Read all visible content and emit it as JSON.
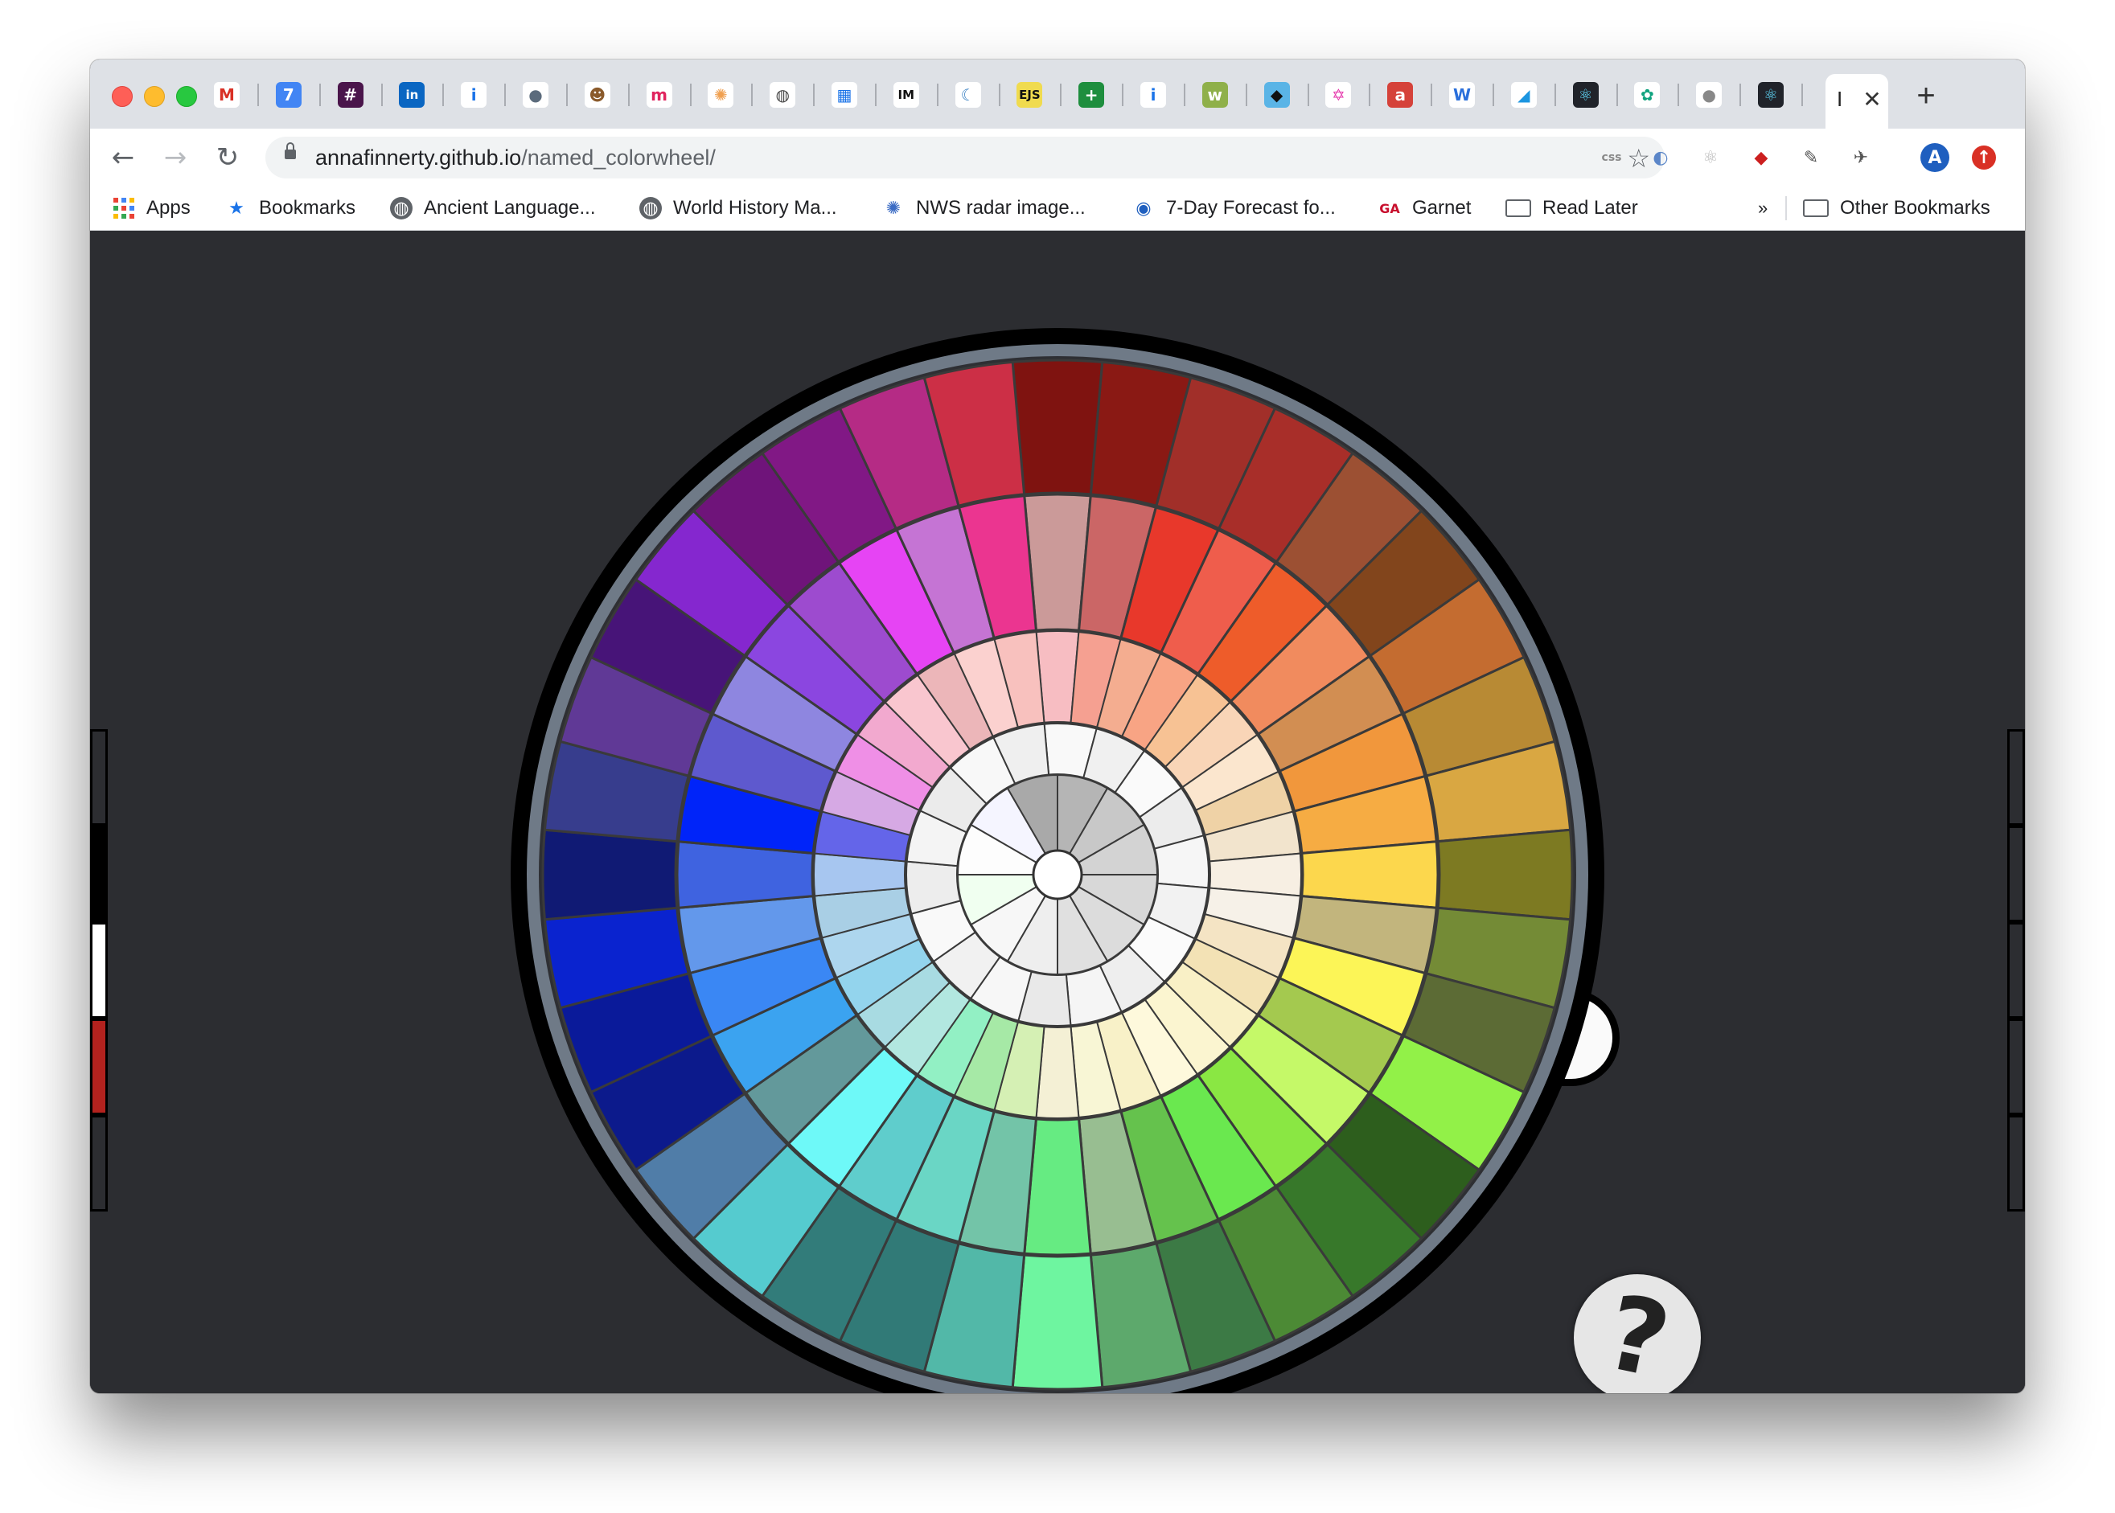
{
  "browser": {
    "pinned_tabs": [
      {
        "icon": "gmail-icon",
        "glyph": "M",
        "bg": "#ffffff",
        "fg": "#d93025"
      },
      {
        "icon": "calendar-icon",
        "glyph": "7",
        "bg": "#4285f4",
        "fg": "#ffffff"
      },
      {
        "icon": "slack-icon",
        "glyph": "#",
        "bg": "#4a154b",
        "fg": "#ffffff"
      },
      {
        "icon": "linkedin-icon",
        "glyph": "in",
        "bg": "#0a66c2",
        "fg": "#ffffff"
      },
      {
        "icon": "info-icon",
        "glyph": "i",
        "bg": "#ffffff",
        "fg": "#1a73e8"
      },
      {
        "icon": "profile-icon",
        "glyph": "●",
        "bg": "#ffffff",
        "fg": "#5b6b7c"
      },
      {
        "icon": "meerkat-icon",
        "glyph": "☻",
        "bg": "#ffffff",
        "fg": "#8a5a2b"
      },
      {
        "icon": "m-logo-icon",
        "glyph": "m",
        "bg": "#ffffff",
        "fg": "#e0245e"
      },
      {
        "icon": "sparkle-icon",
        "glyph": "✺",
        "bg": "#ffffff",
        "fg": "#f0a050"
      },
      {
        "icon": "globe-icon",
        "glyph": "◍",
        "bg": "#ffffff",
        "fg": "#444444"
      },
      {
        "icon": "grid-icon",
        "glyph": "▦",
        "bg": "#ffffff",
        "fg": "#1a73e8"
      },
      {
        "icon": "im-icon",
        "glyph": "IM",
        "bg": "#ffffff",
        "fg": "#111111"
      },
      {
        "icon": "moon-icon",
        "glyph": "☾",
        "bg": "#ffffff",
        "fg": "#3b82c4"
      },
      {
        "icon": "ejs-icon",
        "glyph": "EJS",
        "bg": "#f0db4f",
        "fg": "#111111"
      },
      {
        "icon": "plus-doc-icon",
        "glyph": "+",
        "bg": "#1e8e3e",
        "fg": "#ffffff"
      },
      {
        "icon": "info-icon",
        "glyph": "i",
        "bg": "#ffffff",
        "fg": "#1a73e8"
      },
      {
        "icon": "wp-icon",
        "glyph": "w",
        "bg": "#8fb04a",
        "fg": "#ffffff"
      },
      {
        "icon": "bird-icon",
        "glyph": "◆",
        "bg": "#5ab4e6",
        "fg": "#111111"
      },
      {
        "icon": "graphql-icon",
        "glyph": "✡",
        "bg": "#ffffff",
        "fg": "#e535ab"
      },
      {
        "icon": "a-icon",
        "glyph": "a",
        "bg": "#d5423a",
        "fg": "#ffffff"
      },
      {
        "icon": "w-icon",
        "glyph": "W",
        "bg": "#ffffff",
        "fg": "#2a6fdb"
      },
      {
        "icon": "flag-icon",
        "glyph": "◢",
        "bg": "#ffffff",
        "fg": "#1b95e0"
      },
      {
        "icon": "react-icon",
        "glyph": "⚛",
        "bg": "#20232a",
        "fg": "#61dafb"
      },
      {
        "icon": "openai-icon",
        "glyph": "✿",
        "bg": "#ffffff",
        "fg": "#10a37f"
      },
      {
        "icon": "apple-icon",
        "glyph": "●",
        "bg": "#ffffff",
        "fg": "#888888"
      },
      {
        "icon": "react-icon",
        "glyph": "⚛",
        "bg": "#20232a",
        "fg": "#61dafb"
      }
    ],
    "active_tab": {
      "icon": "page-icon",
      "glyph": "I",
      "close": "✕"
    },
    "new_tab": "+",
    "nav": {
      "back": "←",
      "forward": "→",
      "reload": "↻"
    },
    "url_host": "annafinnerty.github.io",
    "url_path": "/named_colorwheel/",
    "star": "☆",
    "extensions": [
      {
        "icon": "css-icon",
        "glyph": "css",
        "color": "#8a8a8a"
      },
      {
        "icon": "shield-icon",
        "glyph": "◐",
        "color": "#5b86c8"
      },
      {
        "icon": "react-devtools-icon",
        "glyph": "⚛",
        "color": "#bbbbbb"
      },
      {
        "icon": "ruby-icon",
        "glyph": "◆",
        "color": "#cc1f1f"
      },
      {
        "icon": "eyedropper-icon",
        "glyph": "✎",
        "color": "#555555"
      },
      {
        "icon": "plane-icon",
        "glyph": "✈",
        "color": "#555555"
      },
      {
        "icon": "avatar-icon",
        "glyph": "A",
        "color": "#1f5fbf"
      },
      {
        "icon": "update-icon",
        "glyph": "↑",
        "color": "#d93025"
      }
    ],
    "bookmarks": [
      {
        "icon": "apps-icon",
        "label": "Apps"
      },
      {
        "icon": "star-icon",
        "label": "Bookmarks"
      },
      {
        "icon": "globe-icon",
        "label": "Ancient Language..."
      },
      {
        "icon": "globe-icon",
        "label": "World History Ma..."
      },
      {
        "icon": "radar-icon",
        "label": "NWS radar image..."
      },
      {
        "icon": "weather-icon",
        "label": "7-Day Forecast fo..."
      },
      {
        "icon": "ga-icon",
        "label": "Garnet"
      },
      {
        "icon": "folder-icon",
        "label": "Read Later"
      }
    ],
    "overflow": "»",
    "other_bookmarks": "Other Bookmarks",
    "ga_text": "GA"
  },
  "page": {
    "help_label": "?",
    "side_swatches": [
      "#2c2d31",
      "#000000",
      "#ffffff",
      "#b3221e",
      "#2c2d31"
    ],
    "wheel": {
      "rings": [
        {
          "name": "outer",
          "colors": [
            "#7f1310",
            "#8a1914",
            "#a12f29",
            "#a82e29",
            "#9c5033",
            "#82451c",
            "#c46c30",
            "#b88a34",
            "#d9a742",
            "#7d7a22",
            "#748b36",
            "#5c6b35",
            "#92f148",
            "#2d5e1d",
            "#37782a",
            "#4c8a35",
            "#3c7a45",
            "#5da96c",
            "#6ef5a0",
            "#52b8a8",
            "#317a77",
            "#327c7a",
            "#55cbcf",
            "#507da8",
            "#0c1a8c",
            "#0a1a9a",
            "#0a23cf",
            "#101a74",
            "#373d8d",
            "#603996",
            "#471478",
            "#8527cf",
            "#6f147a",
            "#811885",
            "#b52b85",
            "#cc2f46"
          ]
        },
        {
          "name": "second",
          "colors": [
            "#cb9a99",
            "#cb6666",
            "#e8382b",
            "#ef5d4c",
            "#ee5c2a",
            "#f18b5e",
            "#d28e52",
            "#f1973c",
            "#f6ac43",
            "#fcd74d",
            "#c2b57d",
            "#fcf557",
            "#a4c94f",
            "#c5f968",
            "#8ae743",
            "#6ae84f",
            "#65c24d",
            "#98be91",
            "#66eb82",
            "#73c4a8",
            "#6ad6c5",
            "#5fcdcc",
            "#6ef9f8",
            "#63999b",
            "#3ba3f0",
            "#3a87f4",
            "#6398eb",
            "#3f63e0",
            "#0024f9",
            "#5e59ce",
            "#8e86e0",
            "#8b46e0",
            "#9d4bcf",
            "#e644f4",
            "#c574d4",
            "#eb3590"
          ]
        },
        {
          "name": "third",
          "colors": [
            "#f7bdc2",
            "#f5a091",
            "#f4ad90",
            "#f8a484",
            "#f7c294",
            "#f9d5b7",
            "#fbe6ce",
            "#efd2a6",
            "#f2e4cd",
            "#f7efe3",
            "#f6f1e8",
            "#f4e4c4",
            "#f3e2b5",
            "#f9f0c6",
            "#fbf5d0",
            "#fef9dc",
            "#f8f1c8",
            "#f8f6d5",
            "#f4f0d5",
            "#d5f0b4",
            "#a6e9a6",
            "#92f0c4",
            "#b2e7e0",
            "#a8dbe2",
            "#93d4ed",
            "#add6ee",
            "#a9cfe5",
            "#a7c6f0",
            "#6465e9",
            "#d6a9e4",
            "#ef8fe6",
            "#f2a9cf",
            "#f9c6cf",
            "#ecb6b9",
            "#fbd1cf",
            "#f8c1be"
          ]
        },
        {
          "name": "fourth",
          "colors": [
            "#f9f9f9",
            "#f0f0f0",
            "#fafafa",
            "#ececec",
            "#f6f6f6",
            "#f2f2f2",
            "#fbfbfb",
            "#eeeeee",
            "#f5f5f5",
            "#e9e9e9",
            "#f7f7f7",
            "#f1f1f1",
            "#f9f9f9",
            "#ededed",
            "#f4f4f4",
            "#ebebeb",
            "#f8f8f8",
            "#efefef"
          ]
        },
        {
          "name": "center",
          "colors": [
            "#b5b5b5",
            "#c8c8c8",
            "#d3d3d3",
            "#d8d8d8",
            "#dcdcdc",
            "#e0e0e0",
            "#eeeeee",
            "#f7f7f7",
            "#f0fff0",
            "#fdfdfd",
            "#f5f5ff",
            "#a9a9a9"
          ]
        }
      ]
    }
  }
}
